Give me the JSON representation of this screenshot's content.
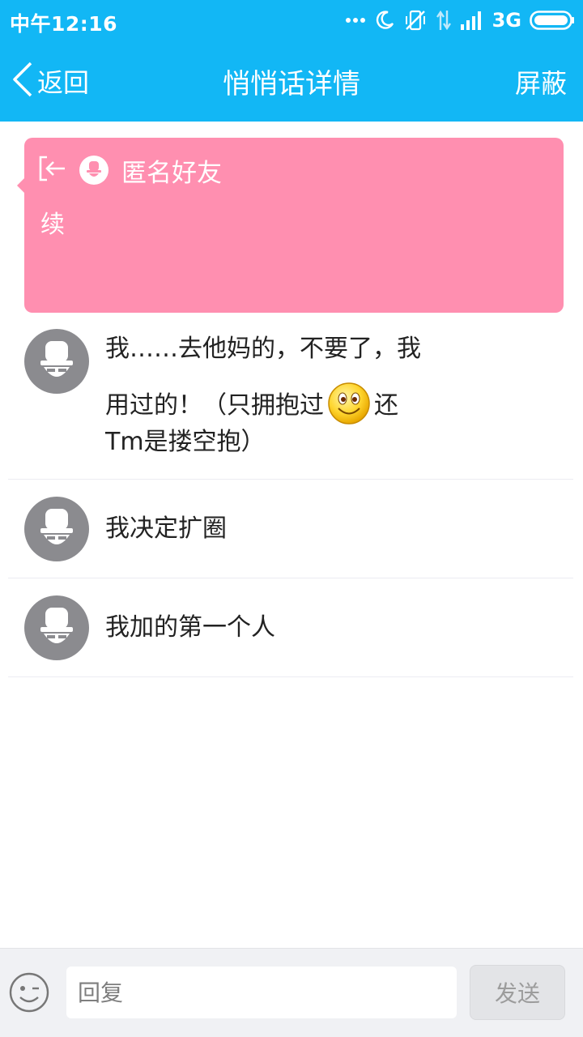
{
  "status_bar": {
    "time": "中午12:16",
    "dots": "...",
    "network": "3G"
  },
  "header": {
    "back_label": "返回",
    "title": "悄悄话详情",
    "block_label": "屏蔽",
    "background": "#12b7f5"
  },
  "whisper": {
    "sender": "匿名好友",
    "text": "续",
    "background": "#ff8fb0"
  },
  "comments": [
    {
      "lines": [
        "我……去他妈的，不要了，我",
        "用过的！（只拥抱过",
        "还",
        "Tm是搂空抱）"
      ],
      "emoji": "smiley-emoji"
    },
    {
      "text": "我决定扩圈"
    },
    {
      "text": "我加的第一个人"
    }
  ],
  "reply_bar": {
    "placeholder": "回复",
    "send_label": "发送"
  }
}
